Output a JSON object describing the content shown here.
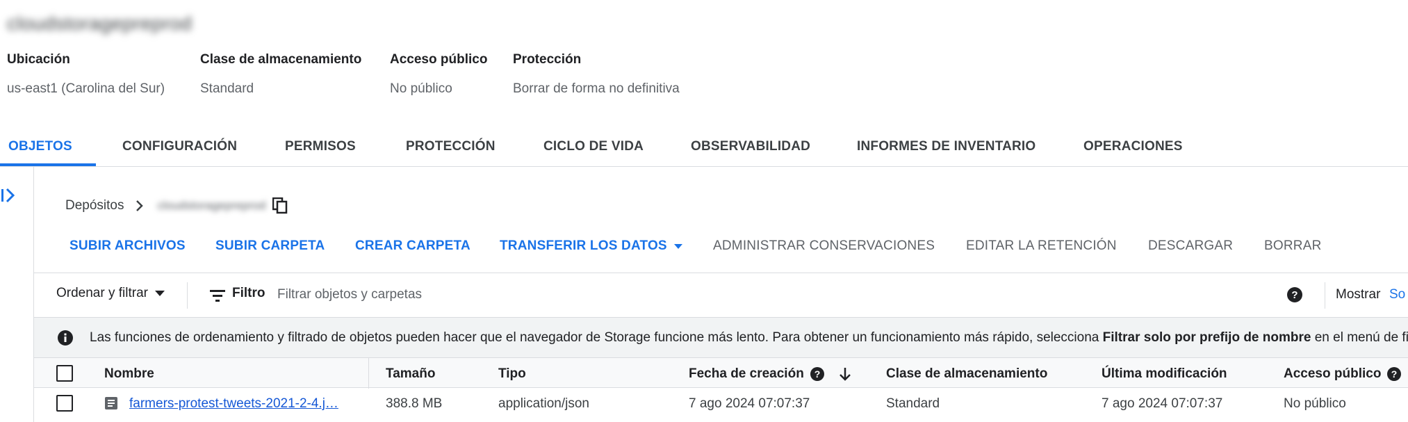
{
  "bucket": {
    "name": "cloudstoragepreprod"
  },
  "meta": [
    {
      "label": "Ubicación",
      "value": "us-east1 (Carolina del Sur)"
    },
    {
      "label": "Clase de almacenamiento",
      "value": "Standard"
    },
    {
      "label": "Acceso público",
      "value": "No público"
    },
    {
      "label": "Protección",
      "value": "Borrar de forma no definitiva"
    }
  ],
  "tabs": [
    {
      "label": "OBJETOS",
      "active": true
    },
    {
      "label": "CONFIGURACIÓN"
    },
    {
      "label": "PERMISOS"
    },
    {
      "label": "PROTECCIÓN"
    },
    {
      "label": "CICLO DE VIDA"
    },
    {
      "label": "OBSERVABILIDAD"
    },
    {
      "label": "INFORMES DE INVENTARIO"
    },
    {
      "label": "OPERACIONES"
    }
  ],
  "breadcrumb": {
    "root": "Depósitos",
    "current": "cloudstoragepreprod"
  },
  "actions": [
    {
      "label": "SUBIR ARCHIVOS",
      "enabled": true
    },
    {
      "label": "SUBIR CARPETA",
      "enabled": true
    },
    {
      "label": "CREAR CARPETA",
      "enabled": true
    },
    {
      "label": "TRANSFERIR LOS DATOS",
      "enabled": true
    },
    {
      "label": "ADMINISTRAR CONSERVACIONES",
      "enabled": false
    },
    {
      "label": "EDITAR LA RETENCIÓN",
      "enabled": false
    },
    {
      "label": "DESCARGAR",
      "enabled": false
    },
    {
      "label": "BORRAR",
      "enabled": false
    }
  ],
  "filter_bar": {
    "sort_label": "Ordenar y filtrar",
    "filter_label": "Filtro",
    "filter_placeholder": "Filtrar objetos y carpetas",
    "show_label": "Mostrar",
    "show_value": "So"
  },
  "info_banner": {
    "text_before": "Las funciones de ordenamiento y filtrado de objetos pueden hacer que el navegador de Storage funcione más lento. Para obtener un funcionamiento más rápido, selecciona ",
    "text_bold": "Filtrar solo por prefijo de nombre",
    "text_after": " en el menú de filtrado."
  },
  "table": {
    "columns": [
      "Nombre",
      "Tamaño",
      "Tipo",
      "Fecha de creación",
      "Clase de almacenamiento",
      "Última modificación",
      "Acceso público"
    ],
    "rows": [
      {
        "name": "farmers-protest-tweets-2021-2-4.j…",
        "size": "388.8 MB",
        "type": "application/json",
        "created": "7 ago 2024 07:07:37",
        "storage_class": "Standard",
        "modified": "7 ago 2024 07:07:37",
        "public_access": "No público"
      }
    ]
  },
  "colors": {
    "accent": "#1a73e8",
    "text": "#202124",
    "muted": "#5f6368",
    "banner_bg": "#f1f3f4"
  }
}
